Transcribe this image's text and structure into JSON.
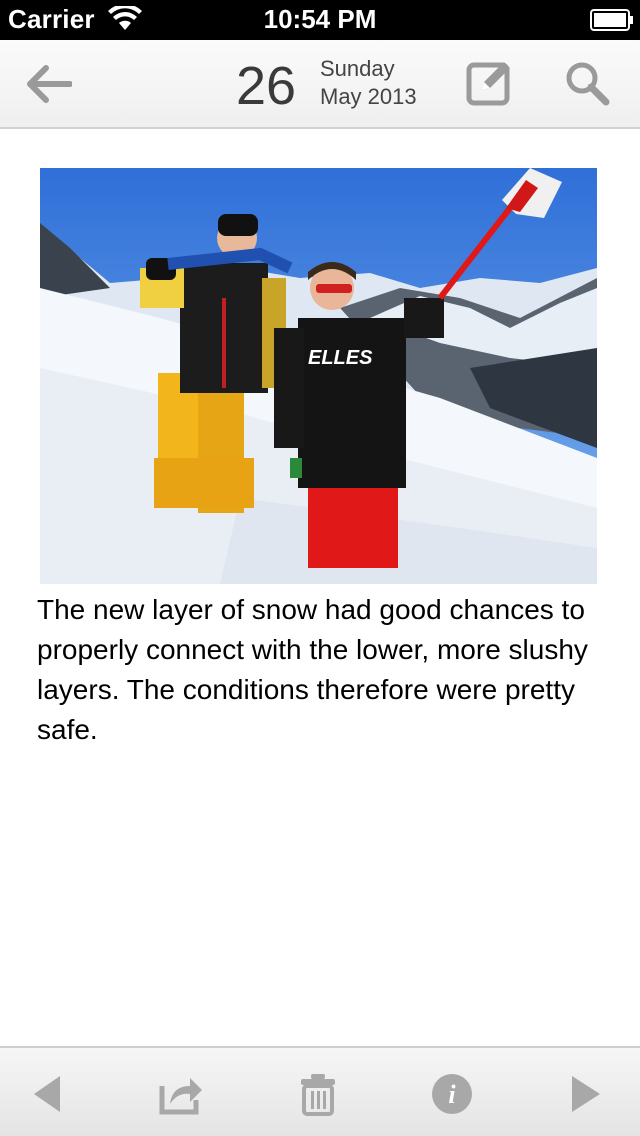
{
  "status_bar": {
    "carrier": "Carrier",
    "time": "10:54 PM"
  },
  "header": {
    "day": "26",
    "weekday": "Sunday",
    "month_year": "May 2013",
    "icons": [
      "back-arrow-icon",
      "compose-icon",
      "search-icon"
    ]
  },
  "entry": {
    "text": "The new layer of snow had good chances to properly connect with the lower, more slushy layers. The conditions therefore were pretty safe.",
    "photo_shirt_text": "ELLES"
  },
  "toolbar": {
    "icons": [
      "previous-icon",
      "share-icon",
      "trash-icon",
      "info-icon",
      "next-icon"
    ],
    "info_glyph": "i"
  },
  "colors": {
    "header_icon": "#9a9a9a",
    "toolbar_icon": "#a8a8a8"
  }
}
